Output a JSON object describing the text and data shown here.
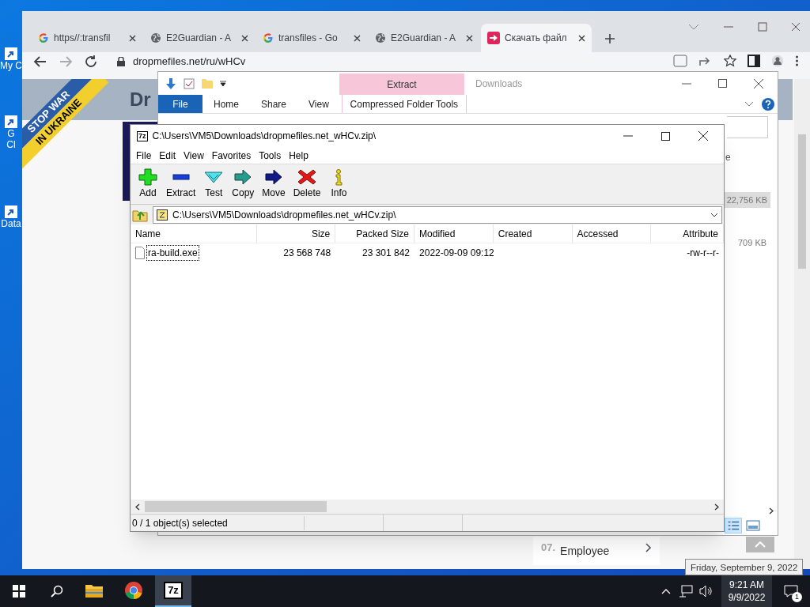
{
  "desktop": {
    "icons": [
      {
        "lines": [
          "My C"
        ]
      },
      {
        "lines": [
          "G",
          "Cl"
        ]
      },
      {
        "lines": [
          "Data"
        ]
      }
    ]
  },
  "browser": {
    "tabs": [
      {
        "title": "https//:transfil",
        "kind": "google",
        "selected": false
      },
      {
        "title": "E2Guardian - A",
        "kind": "globe",
        "selected": false
      },
      {
        "title": "transfiles - Go",
        "kind": "google",
        "selected": false
      },
      {
        "title": "E2Guardian - A",
        "kind": "globe",
        "selected": false
      },
      {
        "title": "Скачать файл",
        "kind": "download",
        "selected": true
      }
    ],
    "address": "dropmefiles.net/ru/wHCv",
    "page": {
      "logo": "Dr",
      "banner": [
        "STOP WAR",
        "IN UKRAINE"
      ],
      "sizes": [
        "22,756 KB",
        "709 KB"
      ],
      "list_number": "07.",
      "list_title": "Employee"
    }
  },
  "explorer": {
    "contextual_tab": "Extract",
    "title": "Downloads",
    "side_text": "e",
    "tabs": [
      {
        "label": "File",
        "kind": "menu"
      },
      {
        "label": "Home",
        "kind": "plain"
      },
      {
        "label": "Share",
        "kind": "plain"
      },
      {
        "label": "View",
        "kind": "plain"
      },
      {
        "label": "Compressed Folder Tools",
        "kind": "contextual"
      }
    ]
  },
  "archiver": {
    "icon_label": "7z",
    "title": "C:\\Users\\VM5\\Downloads\\dropmefiles.net_wHCv.zip\\",
    "menu": [
      "File",
      "Edit",
      "View",
      "Favorites",
      "Tools",
      "Help"
    ],
    "toolbar": [
      {
        "label": "Add",
        "kind": "add"
      },
      {
        "label": "Extract",
        "kind": "extract"
      },
      {
        "label": "Test",
        "kind": "test"
      },
      {
        "label": "Copy",
        "kind": "copy"
      },
      {
        "label": "Move",
        "kind": "move"
      },
      {
        "label": "Delete",
        "kind": "delete"
      },
      {
        "label": "Info",
        "kind": "info"
      }
    ],
    "path": "C:\\Users\\VM5\\Downloads\\dropmefiles.net_wHCv.zip\\",
    "columns": [
      "Name",
      "Size",
      "Packed Size",
      "Modified",
      "Created",
      "Accessed",
      "Attribute"
    ],
    "rows": [
      {
        "name": "ra-build.exe",
        "size": "23 568 748",
        "packed": "23 301 842",
        "modified": "2022-09-09 09:12",
        "attributes": "-rw-r--r-",
        "focused": true
      }
    ],
    "status": "0 / 1 object(s) selected"
  },
  "tooltip": "Friday, September 9, 2022",
  "taskbar": {
    "apps": [
      {
        "kind": "folder",
        "selected": false
      },
      {
        "kind": "chrome",
        "selected": false
      },
      {
        "kind": "sevenzip",
        "label": "7z",
        "selected": true
      }
    ],
    "time": "9:21 AM",
    "date": "9/9/2022",
    "notifications": "1"
  }
}
